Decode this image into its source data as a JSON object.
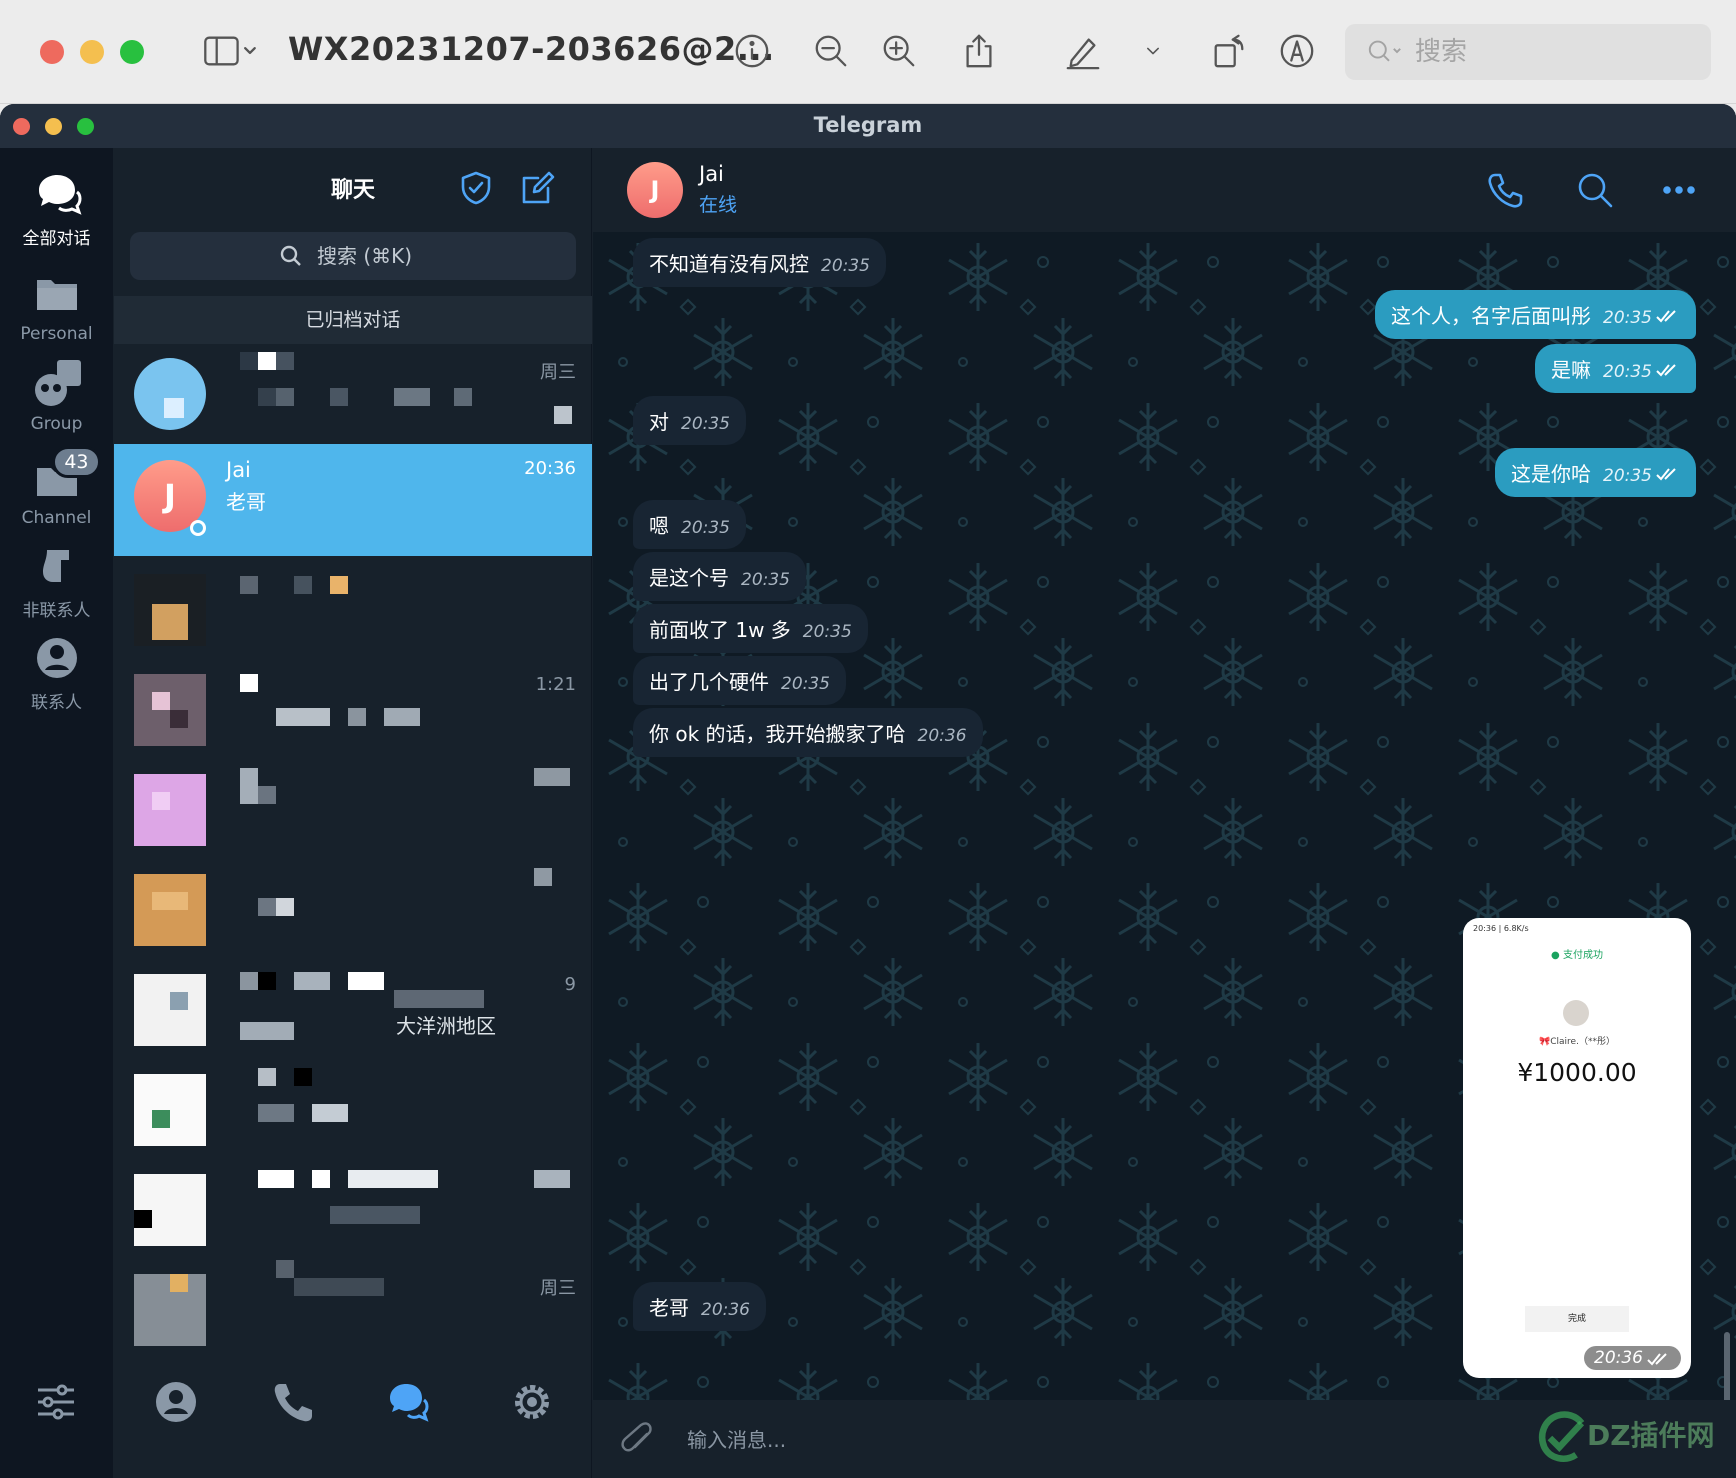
{
  "preview": {
    "title": "WX20231207-203626@2...",
    "search_placeholder": "搜索"
  },
  "telegram": {
    "window_title": "Telegram"
  },
  "folders": [
    {
      "label": "全部对话",
      "icon": "chats-icon",
      "active": true
    },
    {
      "label": "Personal",
      "icon": "folder-icon"
    },
    {
      "label": "Group",
      "icon": "group-icon"
    },
    {
      "label": "Channel",
      "icon": "channel-folder-icon",
      "badge": "43"
    },
    {
      "label": "非联系人",
      "icon": "non-contacts-icon"
    },
    {
      "label": "联系人",
      "icon": "contacts-icon"
    }
  ],
  "chatlist": {
    "title": "聊天",
    "search_placeholder": "搜索 (⌘K)",
    "archived": "已归档对话",
    "rows": [
      {
        "time": "周三"
      },
      {
        "name": "Jai",
        "preview": "老哥",
        "time": "20:36",
        "avatar_letter": "J",
        "active": true
      },
      {
        "time": ""
      },
      {
        "time": "1:21"
      },
      {
        "time": ""
      },
      {
        "time": ""
      },
      {
        "time": "9",
        "preview": "大洋洲地区"
      },
      {
        "time": ""
      },
      {
        "time": ""
      },
      {
        "time": "周三"
      }
    ]
  },
  "chat": {
    "name": "Jai",
    "status": "在线",
    "avatar_letter": "J",
    "input_placeholder": "输入消息..."
  },
  "messages": [
    {
      "dir": "in",
      "text": "不知道有没有风控",
      "time": "20:35"
    },
    {
      "dir": "out",
      "text": "这个人，名字后面叫彤",
      "time": "20:35"
    },
    {
      "dir": "out",
      "text": "是嘛",
      "time": "20:35"
    },
    {
      "dir": "in",
      "text": "对",
      "time": "20:35"
    },
    {
      "dir": "out",
      "text": "这是你哈",
      "time": "20:35"
    },
    {
      "dir": "in",
      "text": "嗯",
      "time": "20:35"
    },
    {
      "dir": "in",
      "text": "是这个号",
      "time": "20:35"
    },
    {
      "dir": "in",
      "text": "前面收了 1w 多",
      "time": "20:35"
    },
    {
      "dir": "in",
      "text": "出了几个硬件",
      "time": "20:35"
    },
    {
      "dir": "in",
      "text": "你 ok 的话，我开始搬家了哈",
      "time": "20:36"
    },
    {
      "dir": "in",
      "text": "老哥",
      "time": "20:36"
    }
  ],
  "image_message": {
    "time": "20:36",
    "status_bar": "20:36 | 6.8K/s",
    "pay_status": "支付成功",
    "payee": "🎀Claire.（**彤）",
    "amount": "¥1000.00",
    "done_button": "完成"
  },
  "watermark": {
    "text": "DZ插件网"
  },
  "colors": {
    "accent": "#4ea4f6",
    "active_row": "#4fb6ec",
    "outgoing_bubble": "#2b9cc0",
    "incoming_bubble": "#182533",
    "sidebar_bg": "#0e1621",
    "panel_bg": "#17212b"
  }
}
